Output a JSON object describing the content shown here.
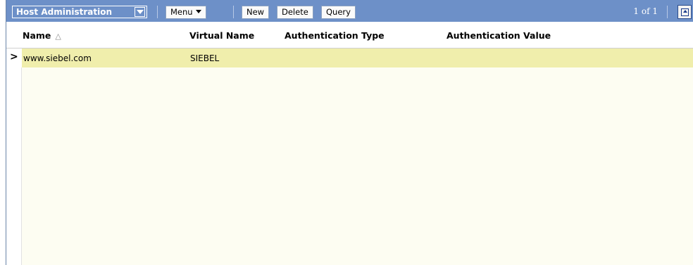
{
  "toolbar": {
    "title": "Host Administration",
    "menu_label": "Menu",
    "new_label": "New",
    "delete_label": "Delete",
    "query_label": "Query",
    "record_count": "1 of 1"
  },
  "grid": {
    "columns": [
      "Name",
      "Virtual Name",
      "Authentication Type",
      "Authentication Value"
    ],
    "rows": [
      {
        "name": "www.siebel.com",
        "virtual_name": "SIEBEL",
        "auth_type": "",
        "auth_value": ""
      }
    ],
    "selected_indicator": ">"
  },
  "colors": {
    "toolbar_bg": "#6d90c8",
    "selected_row": "#f0eeac",
    "body_bg": "#fdfdf2"
  }
}
